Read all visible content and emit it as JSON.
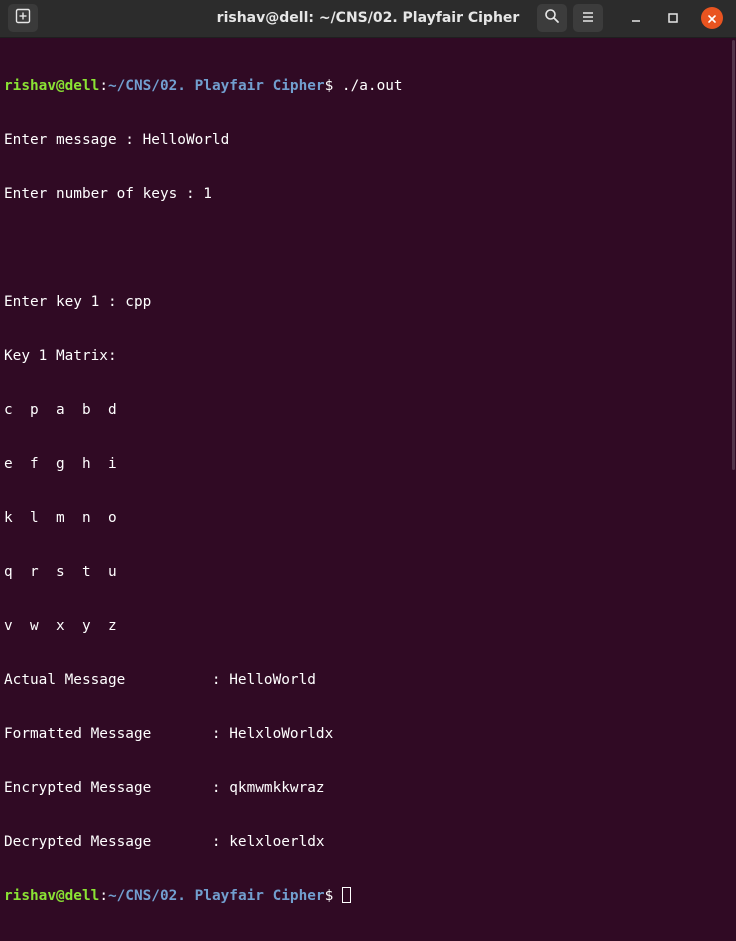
{
  "window": {
    "title": "rishav@dell: ~/CNS/02. Playfair Cipher"
  },
  "icons": {
    "new_tab": "new-tab-icon",
    "search": "search-icon",
    "menu": "hamburger-menu-icon",
    "minimize": "minimize-icon",
    "maximize": "maximize-icon",
    "close": "close-icon"
  },
  "colors": {
    "terminal_bg": "#300a24",
    "titlebar_bg": "#2c2c2c",
    "prompt_user": "#8ae234",
    "prompt_path": "#729fcf",
    "close_button": "#e95420",
    "text": "#ffffff"
  },
  "prompt": {
    "user_host": "rishav@dell",
    "colon": ":",
    "path": "~/CNS/02. Playfair Cipher",
    "symbol": "$ "
  },
  "session": {
    "command": "./a.out",
    "lines": [
      "Enter message : HelloWorld",
      "Enter number of keys : 1",
      "",
      "Enter key 1 : cpp",
      "Key 1 Matrix:",
      "c  p  a  b  d",
      "e  f  g  h  i",
      "k  l  m  n  o",
      "q  r  s  t  u",
      "v  w  x  y  z",
      "Actual Message          : HelloWorld",
      "Formatted Message       : HelxloWorldx",
      "Encrypted Message       : qkmwmkkwraz",
      "Decrypted Message       : kelxloerldx"
    ]
  }
}
